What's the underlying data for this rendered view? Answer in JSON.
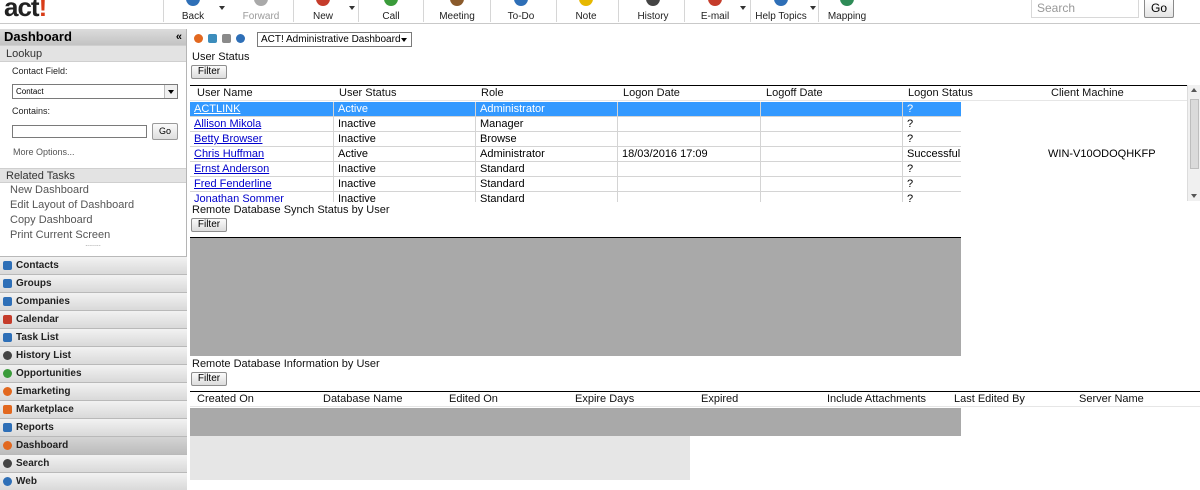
{
  "app": {
    "logo_text": "act",
    "logo_mark": "!"
  },
  "toolbar": {
    "buttons": [
      {
        "label": "Back",
        "icon": "back-arrow-icon",
        "color": "#2e6fb7"
      },
      {
        "label": "Forward",
        "icon": "forward-arrow-icon",
        "color": "#a9a9a9"
      },
      {
        "label": "New",
        "icon": "new-icon",
        "color": "#c53c2b"
      },
      {
        "label": "Call",
        "icon": "phone-icon",
        "color": "#3a9b3a"
      },
      {
        "label": "Meeting",
        "icon": "meeting-icon",
        "color": "#8a5a2b"
      },
      {
        "label": "To-Do",
        "icon": "todo-icon",
        "color": "#2e6fb7"
      },
      {
        "label": "Note",
        "icon": "note-icon",
        "color": "#e6b800"
      },
      {
        "label": "History",
        "icon": "history-icon",
        "color": "#444444"
      },
      {
        "label": "E-mail",
        "icon": "email-icon",
        "color": "#c53c2b"
      },
      {
        "label": "Help Topics",
        "icon": "help-icon",
        "color": "#2e6fb7"
      },
      {
        "label": "Mapping",
        "icon": "globe-icon",
        "color": "#2e8b57"
      }
    ],
    "search_placeholder": "Search",
    "go_label": "Go"
  },
  "sidebar": {
    "title": "Dashboard",
    "collapse_glyph": "«",
    "lookup": {
      "title": "Lookup",
      "contact_field_label": "Contact Field:",
      "contact_field_value": "Contact",
      "contains_label": "Contains:",
      "go_label": "Go",
      "more_options": "More Options..."
    },
    "related_tasks": {
      "title": "Related Tasks",
      "items": [
        "New Dashboard",
        "Edit Layout of Dashboard",
        "Copy Dashboard",
        "Print Current Screen"
      ]
    },
    "grip": "........",
    "nav": [
      {
        "label": "Contacts",
        "icon": "contacts-icon",
        "color": "#2e6fb7",
        "active": false
      },
      {
        "label": "Groups",
        "icon": "groups-icon",
        "color": "#2e6fb7",
        "active": false
      },
      {
        "label": "Companies",
        "icon": "companies-icon",
        "color": "#2e6fb7",
        "active": false
      },
      {
        "label": "Calendar",
        "icon": "calendar-icon",
        "color": "#c53c2b",
        "active": false
      },
      {
        "label": "Task List",
        "icon": "task-list-icon",
        "color": "#2e6fb7",
        "active": false
      },
      {
        "label": "History List",
        "icon": "history-list-icon",
        "color": "#444444",
        "active": false
      },
      {
        "label": "Opportunities",
        "icon": "opportunities-icon",
        "color": "#3a9b3a",
        "active": false
      },
      {
        "label": "Emarketing",
        "icon": "emarketing-icon",
        "color": "#e2681f",
        "active": false
      },
      {
        "label": "Marketplace",
        "icon": "marketplace-icon",
        "color": "#e2681f",
        "active": false
      },
      {
        "label": "Reports",
        "icon": "reports-icon",
        "color": "#2e6fb7",
        "active": false
      },
      {
        "label": "Dashboard",
        "icon": "dashboard-icon",
        "color": "#e2681f",
        "active": true
      },
      {
        "label": "Search",
        "icon": "search-icon",
        "color": "#444444",
        "active": false
      },
      {
        "label": "Web",
        "icon": "web-icon",
        "color": "#2e6fb7",
        "active": false
      }
    ]
  },
  "dashboard": {
    "selected": "ACT! Administrative Dashboard",
    "user_status": {
      "title": "User Status",
      "filter_label": "Filter",
      "columns": [
        "User Name",
        "User Status",
        "Role",
        "Logon Date",
        "Logoff Date",
        "Logon Status",
        "Client Machine"
      ],
      "rows": [
        {
          "user": "ACTLINK",
          "status": "Active",
          "role": "Administrator",
          "logon": "",
          "logoff": "",
          "logon_status": "?",
          "client": "",
          "selected": true
        },
        {
          "user": "Allison Mikola",
          "status": "Inactive",
          "role": "Manager",
          "logon": "",
          "logoff": "",
          "logon_status": "?",
          "client": "",
          "selected": false
        },
        {
          "user": "Betty Browser",
          "status": "Inactive",
          "role": "Browse",
          "logon": "",
          "logoff": "",
          "logon_status": "?",
          "client": "",
          "selected": false
        },
        {
          "user": "Chris Huffman",
          "status": "Active",
          "role": "Administrator",
          "logon": "18/03/2016 17:09",
          "logoff": "",
          "logon_status": "Successful",
          "client": "WIN-V10ODOQHKFP",
          "selected": false
        },
        {
          "user": "Ernst Anderson",
          "status": "Inactive",
          "role": "Standard",
          "logon": "",
          "logoff": "",
          "logon_status": "?",
          "client": "",
          "selected": false
        },
        {
          "user": "Fred Fenderline",
          "status": "Inactive",
          "role": "Standard",
          "logon": "",
          "logoff": "",
          "logon_status": "?",
          "client": "",
          "selected": false
        },
        {
          "user": "Jonathan Sommer",
          "status": "Inactive",
          "role": "Standard",
          "logon": "",
          "logoff": "",
          "logon_status": "?",
          "client": "",
          "selected": false
        }
      ]
    },
    "remote_sync": {
      "title": "Remote Database Synch Status by User",
      "filter_label": "Filter"
    },
    "remote_info": {
      "title": "Remote Database Information by User",
      "filter_label": "Filter",
      "columns": [
        "Created On",
        "Database Name",
        "Edited On",
        "Expire Days",
        "Expired",
        "Include Attachments",
        "Last Edited By",
        "Server Name"
      ]
    }
  }
}
